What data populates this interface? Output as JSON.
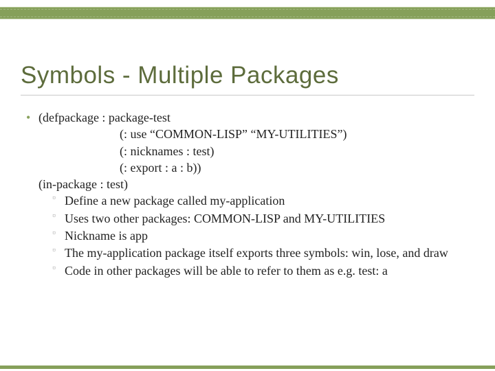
{
  "title": "Symbols - Multiple Packages",
  "code": {
    "l1": "(defpackage  : package-test",
    "l2": "(: use  “COMMON-LISP”  “MY-UTILITIES”)",
    "l3": "(: nicknames  : test)",
    "l4": "(: export  : a  : b))",
    "l5": "(in-package  : test)"
  },
  "sub": {
    "s1": "Define a new package called my-application",
    "s2": "Uses two other packages: COMMON-LISP and MY-UTILITIES",
    "s3": "Nickname is app",
    "s4": "The my-application package itself exports three symbols: win, lose, and draw",
    "s5": "Code in other packages will be able to refer to them as e.g. test: a"
  }
}
